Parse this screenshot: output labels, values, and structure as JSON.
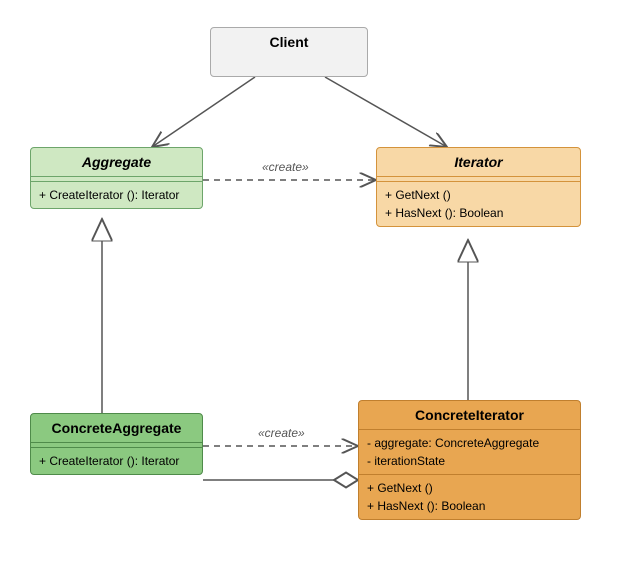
{
  "classes": {
    "client": {
      "title": "Client"
    },
    "aggregate": {
      "title": "Aggregate",
      "ops": [
        "+ CreateIterator (): Iterator"
      ]
    },
    "iterator": {
      "title": "Iterator",
      "ops": [
        "+ GetNext ()",
        "+ HasNext (): Boolean"
      ]
    },
    "concreteAggregate": {
      "title": "ConcreteAggregate",
      "ops": [
        "+ CreateIterator (): Iterator"
      ]
    },
    "concreteIterator": {
      "title": "ConcreteIterator",
      "attrs": [
        "- aggregate: ConcreteAggregate",
        "- iterationState"
      ],
      "ops": [
        "+ GetNext ()",
        "+ HasNext (): Boolean"
      ]
    }
  },
  "relations": {
    "aggregate_to_iterator": "«create»",
    "concAgg_to_concIter": "«create»"
  },
  "chart_data": {
    "type": "uml_class_diagram",
    "pattern": "Iterator",
    "classes": [
      {
        "name": "Client",
        "stereotype": null,
        "abstract": false,
        "attributes": [],
        "operations": []
      },
      {
        "name": "Aggregate",
        "stereotype": "interface",
        "abstract": true,
        "attributes": [],
        "operations": [
          "+ CreateIterator(): Iterator"
        ]
      },
      {
        "name": "Iterator",
        "stereotype": "interface",
        "abstract": true,
        "attributes": [],
        "operations": [
          "+ GetNext()",
          "+ HasNext(): Boolean"
        ]
      },
      {
        "name": "ConcreteAggregate",
        "stereotype": null,
        "abstract": false,
        "attributes": [],
        "operations": [
          "+ CreateIterator(): Iterator"
        ]
      },
      {
        "name": "ConcreteIterator",
        "stereotype": null,
        "abstract": false,
        "attributes": [
          "- aggregate: ConcreteAggregate",
          "- iterationState"
        ],
        "operations": [
          "+ GetNext()",
          "+ HasNext(): Boolean"
        ]
      }
    ],
    "relationships": [
      {
        "from": "Client",
        "to": "Aggregate",
        "type": "association",
        "navigable_to": true
      },
      {
        "from": "Client",
        "to": "Iterator",
        "type": "association",
        "navigable_to": true
      },
      {
        "from": "Aggregate",
        "to": "Iterator",
        "type": "dependency",
        "label": "«create»"
      },
      {
        "from": "ConcreteAggregate",
        "to": "Aggregate",
        "type": "realization"
      },
      {
        "from": "ConcreteIterator",
        "to": "Iterator",
        "type": "realization"
      },
      {
        "from": "ConcreteAggregate",
        "to": "ConcreteIterator",
        "type": "dependency",
        "label": "«create»"
      },
      {
        "from": "ConcreteIterator",
        "to": "ConcreteAggregate",
        "type": "aggregation"
      }
    ]
  }
}
